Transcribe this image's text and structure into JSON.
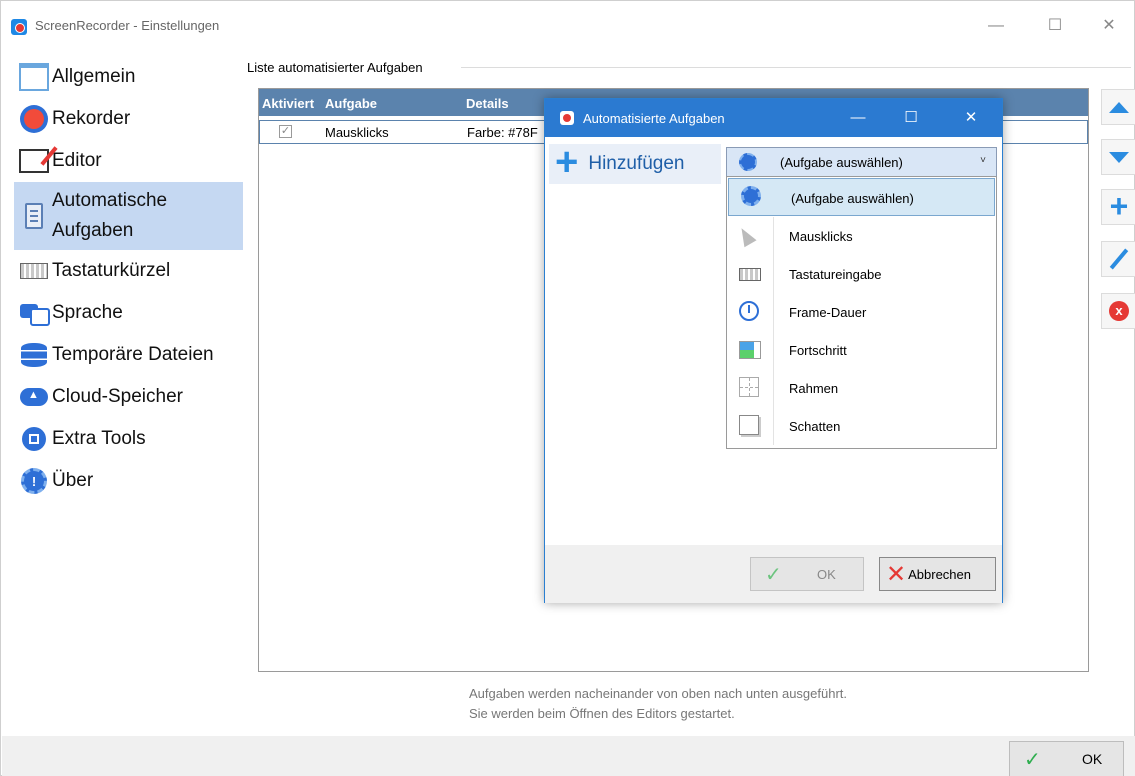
{
  "window": {
    "title": "ScreenRecorder - Einstellungen",
    "controls": {
      "minimize": "—",
      "maximize": "☐",
      "close": "✕"
    }
  },
  "sidebar": {
    "items": [
      {
        "label": "Allgemein",
        "icon": "window-icon"
      },
      {
        "label": "Rekorder",
        "icon": "record-icon"
      },
      {
        "label": "Editor",
        "icon": "editor-icon"
      },
      {
        "label": "Automatische Aufgaben",
        "icon": "clipboard-icon",
        "active": true
      },
      {
        "label": "Tastaturkürzel",
        "icon": "keyboard-icon"
      },
      {
        "label": "Sprache",
        "icon": "language-icon"
      },
      {
        "label": "Temporäre Dateien",
        "icon": "database-icon"
      },
      {
        "label": "Cloud-Speicher",
        "icon": "cloud-icon"
      },
      {
        "label": "Extra Tools",
        "icon": "chip-icon"
      },
      {
        "label": "Über",
        "icon": "gear-icon"
      }
    ]
  },
  "tasks": {
    "group_label": "Liste automatisierter Aufgaben",
    "columns": [
      "Aktiviert",
      "Aufgabe",
      "Details"
    ],
    "rows": [
      {
        "enabled": true,
        "check": "✓",
        "task": "Mausklicks",
        "details": "Farbe: #78F"
      }
    ]
  },
  "toolbar": {
    "move_up": "move-up-icon",
    "move_down": "move-down-icon",
    "add": "+",
    "edit": "edit-icon",
    "remove": "x"
  },
  "footer": {
    "hint_line1": "Aufgaben werden nacheinander von oben nach unten ausgeführt.",
    "hint_line2": "Sie werden beim Öffnen des Editors gestartet.",
    "ok_check": "✓",
    "ok_label": "OK"
  },
  "dialog": {
    "title": "Automatisierte Aufgaben",
    "controls": {
      "minimize": "—",
      "maximize": "☐",
      "close": "✕"
    },
    "add_plus": "+",
    "add_label": "Hinzufügen",
    "select_value": "(Aufgabe auswählen)",
    "select_chevron": "˅",
    "options": [
      {
        "label": "(Aufgabe auswählen)",
        "icon": "gear-icon",
        "selected": true
      },
      {
        "label": "Mausklicks",
        "icon": "cursor-icon"
      },
      {
        "label": "Tastatureingabe",
        "icon": "keyboard-icon"
      },
      {
        "label": "Frame-Dauer",
        "icon": "clock-icon"
      },
      {
        "label": "Fortschritt",
        "icon": "progress-icon"
      },
      {
        "label": "Rahmen",
        "icon": "frame-icon"
      },
      {
        "label": "Schatten",
        "icon": "shadow-icon"
      }
    ],
    "ok_check": "✓",
    "ok_label": "OK",
    "cancel_x": "✕",
    "cancel_label": "Abbrechen"
  },
  "colors": {
    "accent": "#2b7ad1",
    "header": "#5b83ad",
    "sidebar_active": "#c5d8f2",
    "danger": "#e53935",
    "success": "#2fae4f"
  }
}
